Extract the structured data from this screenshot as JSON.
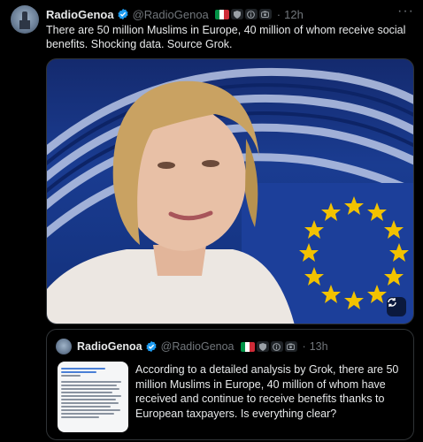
{
  "post": {
    "display_name": "RadioGenoa",
    "handle": "@RadioGenoa",
    "time": "12h",
    "separator": "·",
    "more_menu": "···",
    "text": "There are 50 million Muslims in Europe, 40 million of whom receive social benefits. Shocking data. Source Grok."
  },
  "quote": {
    "display_name": "RadioGenoa",
    "handle": "@RadioGenoa",
    "time": "13h",
    "separator": "·",
    "text": "According to a detailed analysis by Grok, there are 50 million Muslims in Europe, 40 million of whom have received and continue to receive benefits thanks to European taxpayers. Is everything clear?"
  },
  "icons": [
    "verified-icon",
    "italy-flag-icon",
    "shield-badge-icon",
    "info-badge-icon",
    "camera-badge-icon",
    "more-icon",
    "media-alt-icon"
  ],
  "colors": {
    "background": "#000000",
    "text": "#e7e9ea",
    "muted": "#71767b",
    "verified": "#1d9bf0",
    "border": "#2f3336",
    "eu_blue": "#1a3c91",
    "eu_star": "#f2c200"
  }
}
